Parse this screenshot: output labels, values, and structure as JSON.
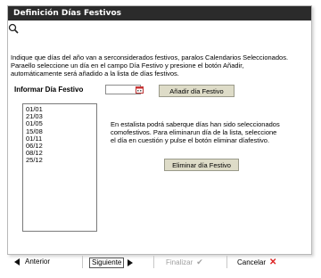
{
  "window": {
    "title": "Definición Días Festivos"
  },
  "intro_text": "Indique que días del año van a serconsiderados festivos, paralos Calendarios Seleccionados. Paraello seleccione un día en el campo Día Festivo y presione el botón Añadir, automáticamente será añadido a la lista de días festivos.",
  "form": {
    "inform_label": "Informar Día Festivo",
    "date_value": "",
    "add_button": "Añadir día Festivo"
  },
  "holidays": [
    "01/01",
    "21/03",
    "01/05",
    "15/08",
    "01/11",
    "06/12",
    "08/12",
    "25/12"
  ],
  "help_text": "En estalista podrá saberque días han sido seleccionados comofestivos. Para eliminarun día de la lista, seleccione el día en cuestión y pulse el botón eliminar díafestivo.",
  "delete_button": "Eliminar día Festivo",
  "footer": {
    "prev_label": "Anterior",
    "next_label": "Siguiente",
    "finish_label": "Finalizar",
    "cancel_label": "Cancelar"
  },
  "icons": {
    "search": "magnifier-icon",
    "calendar": "calendar-icon",
    "prev": "triangle-left-icon",
    "next": "triangle-right-icon",
    "finish": "check-icon",
    "cancel": "x-icon"
  },
  "colors": {
    "titlebar": "#2b2b2b",
    "button": "#dedcc8",
    "cancel_x": "#dd2222",
    "disabled": "#a0a0a0"
  }
}
